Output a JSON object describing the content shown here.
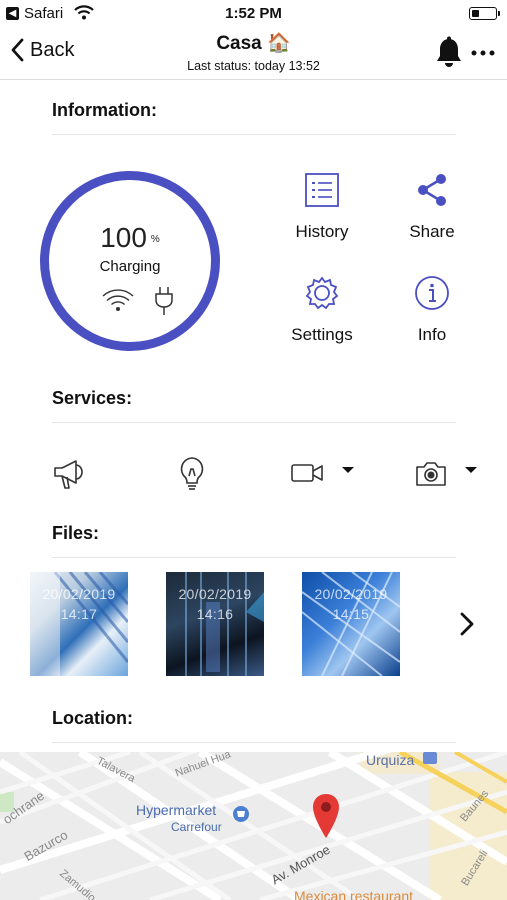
{
  "status_bar": {
    "carrier": "Safari",
    "time": "1:52 PM",
    "battery_level": 0.3
  },
  "nav": {
    "back_label": "Back",
    "title": "Casa 🏠",
    "subtitle": "Last status: today 13:52"
  },
  "information": {
    "title": "Information:",
    "battery_value": "100",
    "battery_unit": "%",
    "battery_status": "Charging",
    "actions": {
      "history": "History",
      "share": "Share",
      "settings": "Settings",
      "info": "Info"
    }
  },
  "services": {
    "title": "Services:"
  },
  "files": {
    "title": "Files:",
    "items": [
      {
        "date": "20/02/2019",
        "time": "14:17"
      },
      {
        "date": "20/02/2019",
        "time": "14:16"
      },
      {
        "date": "20/02/2019",
        "time": "14:15"
      }
    ]
  },
  "location": {
    "title": "Location:",
    "map_labels": {
      "urquiza": "Urquiza",
      "talavera": "Talavera",
      "nahuel": "Nahuel Hua",
      "hypermarket": "Hypermarket",
      "carrefour": "Carrefour",
      "cochrane": "ochrane",
      "bazurco": "Bazurco",
      "zamudio": "Zamudio",
      "monroe": "Av. Monroe",
      "baunes": "Baunes",
      "bucarelli": "Bucareli",
      "mexican": "Mexican restaurant"
    }
  },
  "colors": {
    "accent": "#4a4fc2",
    "pin": "#e53935"
  }
}
